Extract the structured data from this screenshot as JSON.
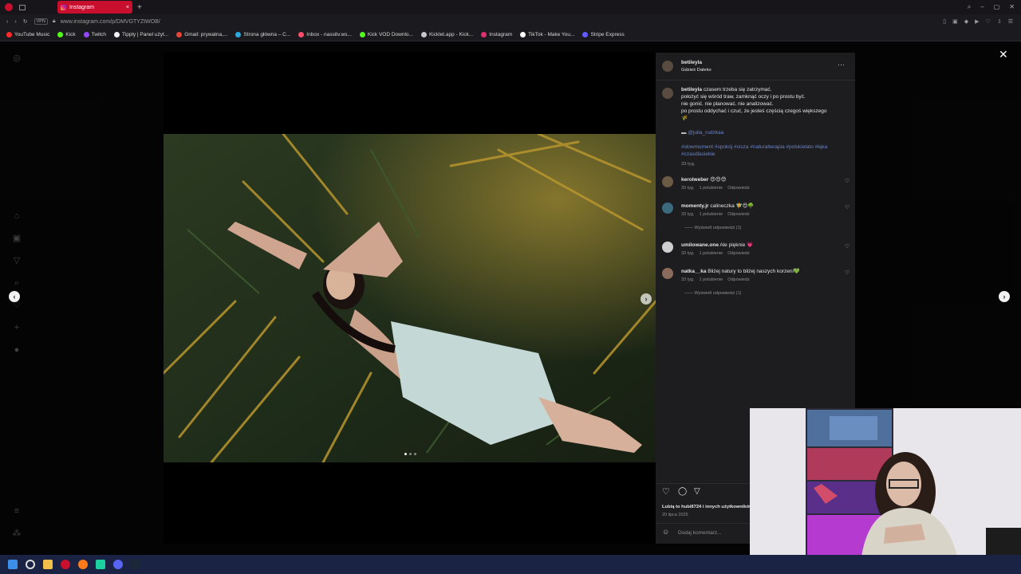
{
  "browser": {
    "tab_title": "Instagram",
    "url": "www.instagram.com/p/DMVGTYZtWOB/",
    "bookmarks": [
      {
        "label": "YouTube Music",
        "color": "#ff2a2a"
      },
      {
        "label": "Kick",
        "color": "#53fc18"
      },
      {
        "label": "Twitch",
        "color": "#9146ff"
      },
      {
        "label": "Tipply | Panel użyt...",
        "color": "#f2f2f2"
      },
      {
        "label": "Gmail: prywatna,...",
        "color": "#ea4335"
      },
      {
        "label": "Strona główna – C...",
        "color": "#2aa8e0"
      },
      {
        "label": "Inbox - nassitv.ws...",
        "color": "#ff4d6d"
      },
      {
        "label": "Kick VOD Downlo...",
        "color": "#53fc18"
      },
      {
        "label": "Kicklet.app - Kick...",
        "color": "#c8c8c8"
      },
      {
        "label": "Instagram",
        "color": "#e1306c"
      },
      {
        "label": "TikTok - Make You...",
        "color": "#ffffff"
      },
      {
        "label": "Stripe Express",
        "color": "#635bff"
      }
    ]
  },
  "post": {
    "author": "betileyla",
    "location": "Gdzieś Daleko",
    "caption_lines": [
      "czasem trzeba się zatrzymać.",
      "położyć się wśród traw, zamknąć oczy i po prostu być.",
      "nie gonić. nie planować. nie analizować.",
      "po prostu oddychać i czuć, że jesteś częścią czegoś większego"
    ],
    "caption_emoji": "🌾",
    "tagged": "@julia_rudzkaa",
    "hashtags_line1": "#slowmoment #spokój #cisza #naturalterapia #polskielato #łąka",
    "hashtags_line2": "#czasdlasiebie",
    "caption_age": "33 tyg.",
    "likes_text": "Lubią to hubi8724 i innych użytkowników",
    "date": "20 lipca 2025",
    "add_comment_placeholder": "Dodaj komentarz..."
  },
  "comments": [
    {
      "user": "kerolweber",
      "text": "😍😍😍",
      "meta": "33 tyg.",
      "likes": "1 polubienie",
      "reply": "Odpowiedz",
      "avatar_color": "#6b5a44"
    },
    {
      "user": "momenty.jr",
      "text": "calineczka 🧚😍🌳",
      "meta": "33 tyg.",
      "likes": "1 polubienie",
      "reply": "Odpowiedz",
      "view_replies": "Wyświetl odpowiedzi (1)",
      "avatar_color": "#3b6a7c"
    },
    {
      "user": "umilowane.one",
      "text": "Ale pięknie 💗",
      "meta": "33 tyg.",
      "likes": "1 polubienie",
      "reply": "Odpowiedz",
      "avatar_color": "#cfcfcf"
    },
    {
      "user": "natka__ka",
      "text": "Bliżej natury to bliżej naszych korzeni💚",
      "meta": "33 tyg.",
      "likes": "1 polubienie",
      "reply": "Odpowiedz",
      "view_replies": "Wyświetl odpowiedzi (1)",
      "avatar_color": "#8a6a5a"
    }
  ],
  "icons": {
    "close": "close-icon",
    "more": "more-options-icon",
    "like": "heart-icon",
    "comment": "comment-icon",
    "share": "share-icon",
    "emoji": "emoji-icon"
  }
}
